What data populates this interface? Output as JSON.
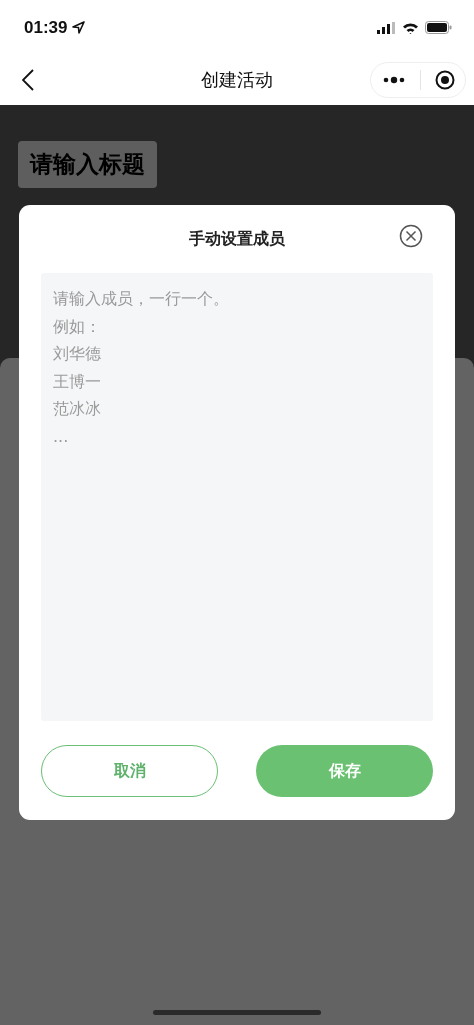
{
  "status_bar": {
    "time": "01:39"
  },
  "nav_bar": {
    "title": "创建活动"
  },
  "page": {
    "title_placeholder": "请输入标题"
  },
  "dialog": {
    "title": "手动设置成员",
    "members_field": {
      "placeholder_lines": [
        "请输入成员，一行一个。",
        "例如：",
        "刘华德",
        "王博一",
        "范冰冰",
        "..."
      ]
    },
    "buttons": [
      {
        "label": "取消",
        "kind": "secondary"
      },
      {
        "label": "保存",
        "kind": "primary"
      }
    ]
  }
}
